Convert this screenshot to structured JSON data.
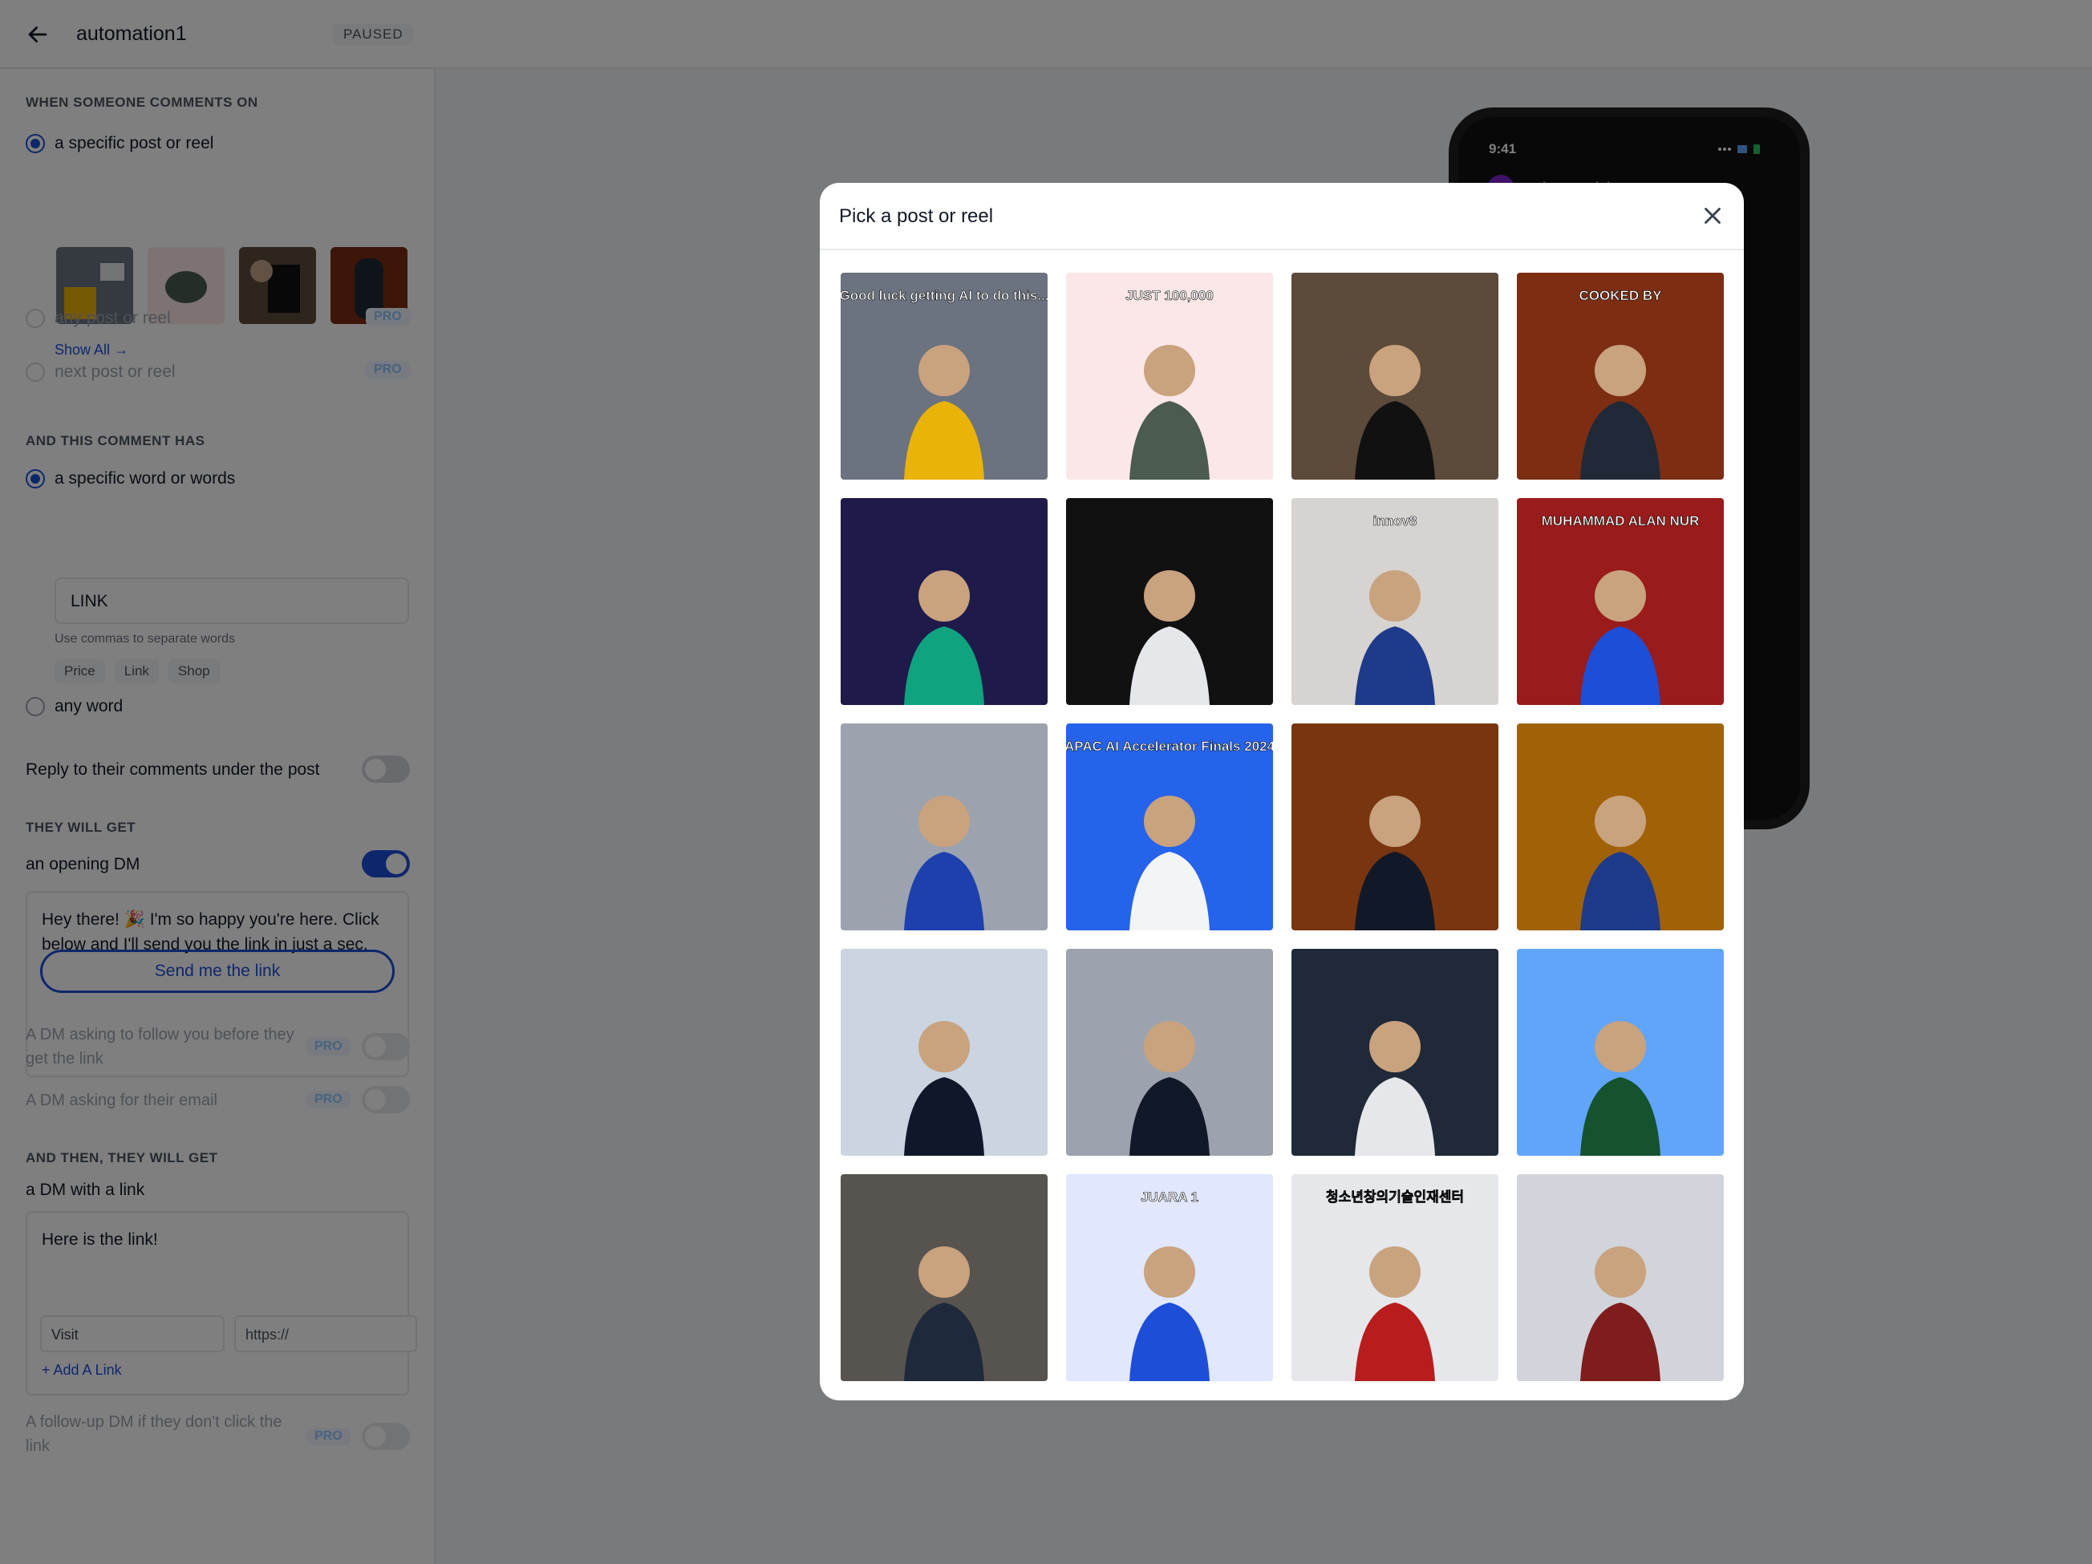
{
  "header": {
    "title": "automation1",
    "status": "PAUSED"
  },
  "trigger": {
    "section_title": "WHEN SOMEONE COMMENTS ON",
    "option_specific": "a specific post or reel",
    "show_all": "Show All →",
    "option_any": "any post or reel",
    "option_next": "next post or reel",
    "pro": "PRO"
  },
  "comment": {
    "section_title": "AND THIS COMMENT HAS",
    "option_specific": "a specific word or words",
    "word_value": "LINK",
    "hint": "Use commas to separate words",
    "chips": [
      "Price",
      "Link",
      "Shop"
    ],
    "option_any": "any word",
    "reply_label": "Reply to their comments under the post"
  },
  "they_get": {
    "section_title": "THEY WILL GET",
    "opening_dm_label": "an opening DM",
    "opening_dm_text": "Hey there! 🎉 I'm so happy you're here. Click below and I'll send you the link in just a sec.",
    "button_label": "Send me the link",
    "follow_label": "A DM asking to follow you before they get the link",
    "email_label": "A DM asking for their email"
  },
  "then": {
    "section_title": "AND THEN, THEY WILL GET",
    "dm_link_label": "a DM with a link",
    "dm_text": "Here is the link!",
    "link_title_value": "Visit",
    "link_url_placeholder": "https://",
    "add_link": "+ Add A Link",
    "followup_label": "A follow-up DM if they don't click the link"
  },
  "phone": {
    "time": "9:41",
    "username": "muhammadalannur"
  },
  "modal": {
    "title": "Pick a post or reel",
    "posts": [
      {
        "caption": "Good luck getting AI to do this...",
        "bg": "#6b7280",
        "accent": "#eab308",
        "icon": "robot-arm"
      },
      {
        "caption": "JUST 100,000",
        "bg": "#fbe7e7",
        "accent": "#4b5b4f",
        "icon": "beanie"
      },
      {
        "caption": "",
        "bg": "#5c4a3a",
        "accent": "#111111",
        "icon": "person-list"
      },
      {
        "caption": "COOKED BY",
        "bg": "#7c2d12",
        "accent": "#1f2937",
        "icon": "robot"
      },
      {
        "caption": "",
        "bg": "#1e1b4b",
        "accent": "#10a37f",
        "icon": "mystery-person"
      },
      {
        "caption": "",
        "bg": "#111111",
        "accent": "#e5e7eb",
        "icon": "person-money"
      },
      {
        "caption": "innov8",
        "bg": "#d6d3d1",
        "accent": "#1e3a8a",
        "icon": "person-wall"
      },
      {
        "caption": "MUHAMMAD ALAN NUR",
        "bg": "#991b1b",
        "accent": "#1d4ed8",
        "icon": "person-red"
      },
      {
        "caption": "",
        "bg": "#9ca3af",
        "accent": "#1e40af",
        "icon": "group-flags"
      },
      {
        "caption": "APAC AI Accelerator Finals 2024",
        "bg": "#2563eb",
        "accent": "#f3f4f6",
        "icon": "group-stage"
      },
      {
        "caption": "",
        "bg": "#78350f",
        "accent": "#111827",
        "icon": "crowd"
      },
      {
        "caption": "",
        "bg": "#a16207",
        "accent": "#1e3a8a",
        "icon": "person-gold"
      },
      {
        "caption": "",
        "bg": "#cbd5e1",
        "accent": "#0f172a",
        "icon": "tower"
      },
      {
        "caption": "",
        "bg": "#9ca3af",
        "accent": "#111827",
        "icon": "sitting"
      },
      {
        "caption": "",
        "bg": "#1f2937",
        "accent": "#e5e7eb",
        "icon": "stage"
      },
      {
        "caption": "",
        "bg": "#60a5fa",
        "accent": "#14532d",
        "icon": "temple"
      },
      {
        "caption": "",
        "bg": "#57534e",
        "accent": "#1e293b",
        "icon": "cafe"
      },
      {
        "caption": "JUARA 1",
        "bg": "#e0e7ff",
        "accent": "#1d4ed8",
        "icon": "collage"
      },
      {
        "caption": "청소년창의기술인재센터",
        "bg": "#e5e7eb",
        "accent": "#b91c1c",
        "icon": "korea"
      },
      {
        "caption": "",
        "bg": "#d1d5db",
        "accent": "#7f1d1d",
        "icon": "selfie"
      }
    ]
  },
  "colors": {
    "accent": "#1d4ed8",
    "overlay": "rgba(0,0,0,0.5)",
    "pro_badge": "#93c5fd"
  }
}
